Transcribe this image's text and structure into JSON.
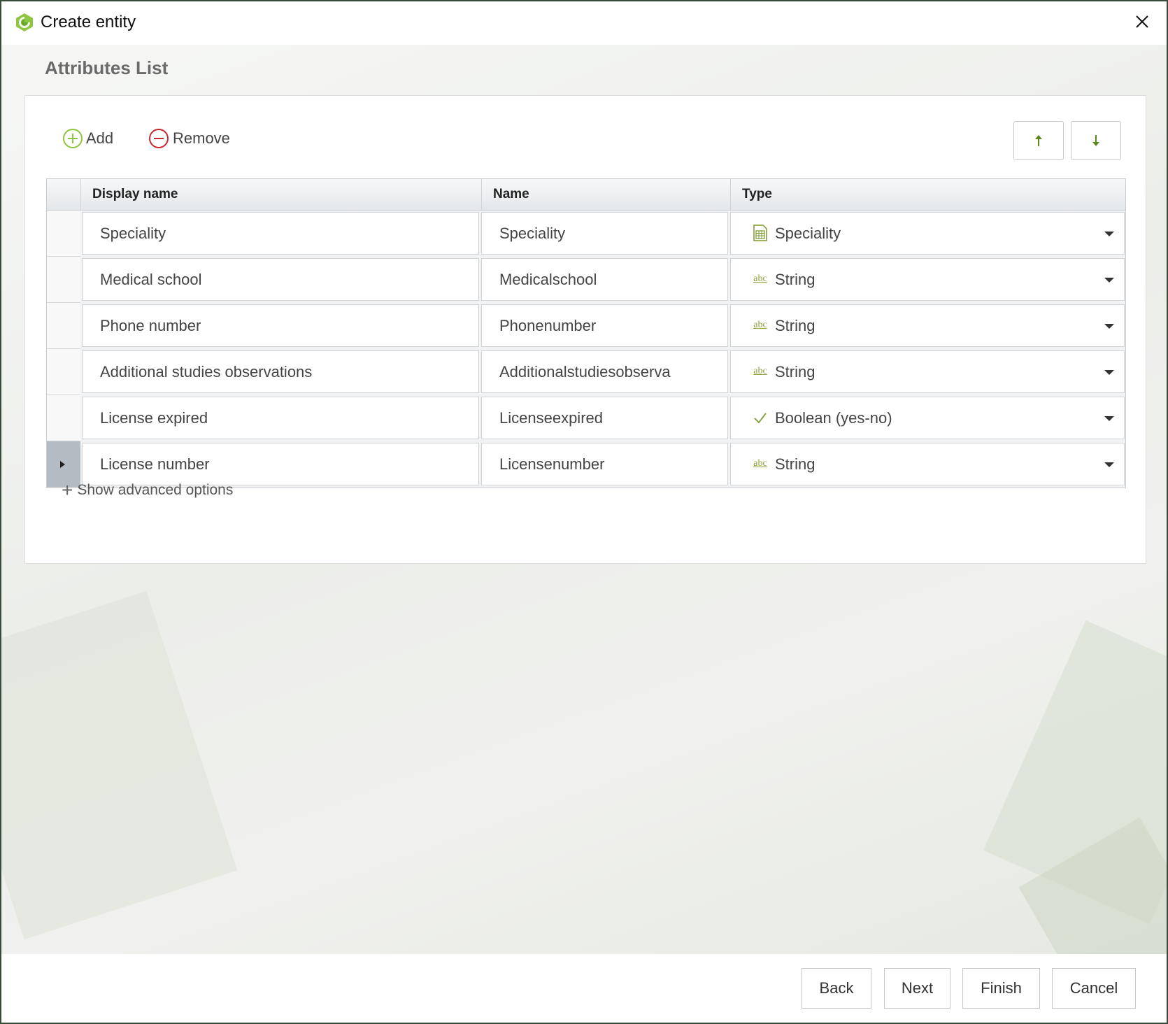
{
  "window": {
    "title": "Create entity"
  },
  "section": {
    "title": "Attributes List"
  },
  "toolbar": {
    "add_label": "Add",
    "remove_label": "Remove",
    "move_up_icon": "arrow-up-icon",
    "move_down_icon": "arrow-down-icon"
  },
  "grid": {
    "columns": [
      "Display name",
      "Name",
      "Type"
    ],
    "rows": [
      {
        "display_name": "Speciality",
        "name": "Speciality",
        "type": "Speciality",
        "type_icon": "table-icon",
        "selected": false
      },
      {
        "display_name": "Medical school",
        "name": "Medicalschool",
        "type": "String",
        "type_icon": "abc-icon",
        "selected": false
      },
      {
        "display_name": "Phone number",
        "name": "Phonenumber",
        "type": "String",
        "type_icon": "abc-icon",
        "selected": false
      },
      {
        "display_name": "Additional studies observations",
        "name": "Additionalstudiesobserva",
        "type": "String",
        "type_icon": "abc-icon",
        "selected": false
      },
      {
        "display_name": "License expired",
        "name": "Licenseexpired",
        "type": "Boolean (yes-no)",
        "type_icon": "check-icon",
        "selected": false
      },
      {
        "display_name": "License number",
        "name": "Licensenumber",
        "type": "String",
        "type_icon": "abc-icon",
        "selected": true
      }
    ],
    "abc_glyph": "abc"
  },
  "advanced": {
    "label": "Show advanced options"
  },
  "footer": {
    "back_label": "Back",
    "next_label": "Next",
    "finish_label": "Finish",
    "cancel_label": "Cancel"
  },
  "colors": {
    "accent_green": "#8dc63f",
    "remove_red": "#c8282e",
    "selected_row": "#b4bcc3"
  }
}
